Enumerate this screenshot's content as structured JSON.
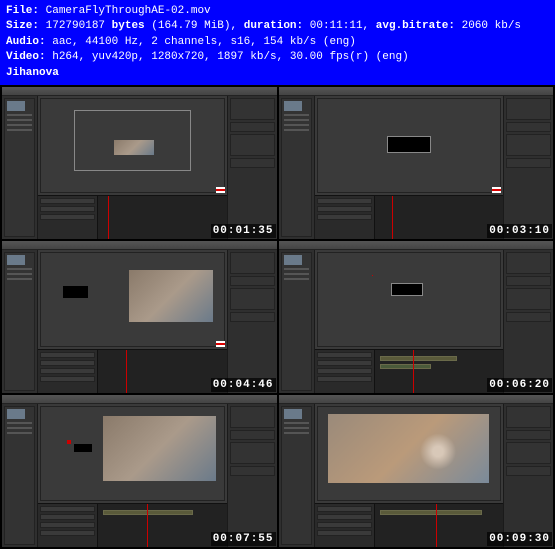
{
  "info": {
    "file_label": "File:",
    "file_value": "CameraFlyThroughAE-02.mov",
    "size_label": "Size:",
    "size_bytes": "172790187",
    "bytes_label": "bytes",
    "size_mib": "(164.79 MiB),",
    "duration_label": "duration:",
    "duration_value": "00:11:11,",
    "bitrate_label": "avg.bitrate:",
    "bitrate_value": "2060 kb/s",
    "audio_label": "Audio:",
    "audio_value": "aac, 44100 Hz, 2 channels, s16, 154 kb/s (eng)",
    "video_label": "Video:",
    "video_value": "h264, yuv420p, 1280x720, 1897 kb/s, 30.00 fps(r) (eng)",
    "author": "Jihanova"
  },
  "thumbs": [
    {
      "ts": "00:01:35"
    },
    {
      "ts": "00:03:10"
    },
    {
      "ts": "00:04:46"
    },
    {
      "ts": "00:06:20"
    },
    {
      "ts": "00:07:55"
    },
    {
      "ts": "00:09:30"
    }
  ]
}
